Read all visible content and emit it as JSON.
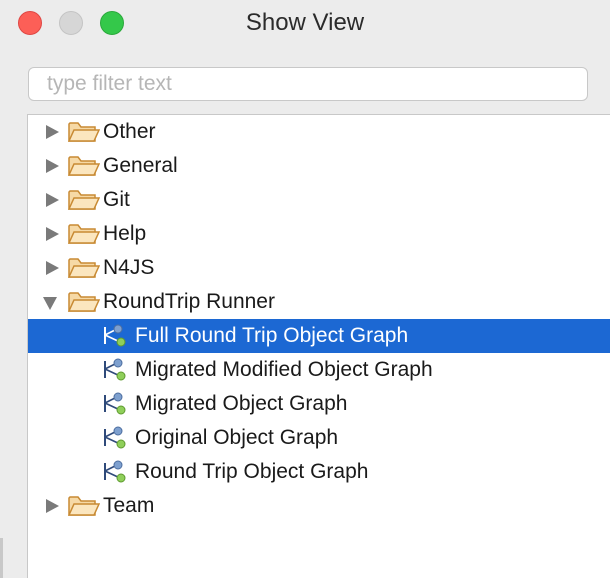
{
  "window": {
    "title": "Show View"
  },
  "filter": {
    "placeholder": "type filter text",
    "value": ""
  },
  "tree": {
    "items": [
      {
        "label": "Other",
        "kind": "folder",
        "expanded": false
      },
      {
        "label": "General",
        "kind": "folder",
        "expanded": false
      },
      {
        "label": "Git",
        "kind": "folder",
        "expanded": false
      },
      {
        "label": "Help",
        "kind": "folder",
        "expanded": false
      },
      {
        "label": "N4JS",
        "kind": "folder",
        "expanded": false
      },
      {
        "label": "RoundTrip Runner",
        "kind": "folder",
        "expanded": true
      },
      {
        "label": "Full Round Trip Object Graph",
        "kind": "view",
        "selected": true
      },
      {
        "label": "Migrated Modified Object Graph",
        "kind": "view"
      },
      {
        "label": "Migrated Object Graph",
        "kind": "view"
      },
      {
        "label": "Original Object Graph",
        "kind": "view"
      },
      {
        "label": "Round Trip Object Graph",
        "kind": "view"
      },
      {
        "label": "Team",
        "kind": "folder",
        "expanded": false
      }
    ]
  },
  "icons": {
    "folder": "folder-icon",
    "view": "object-graph-view-icon",
    "collapsed": "chevron-right-icon",
    "expanded": "chevron-down-icon"
  },
  "colors": {
    "selection": "#1c68d3",
    "close": "#fc5f57",
    "maximize": "#34c84a",
    "folder": "#e5a44a"
  }
}
